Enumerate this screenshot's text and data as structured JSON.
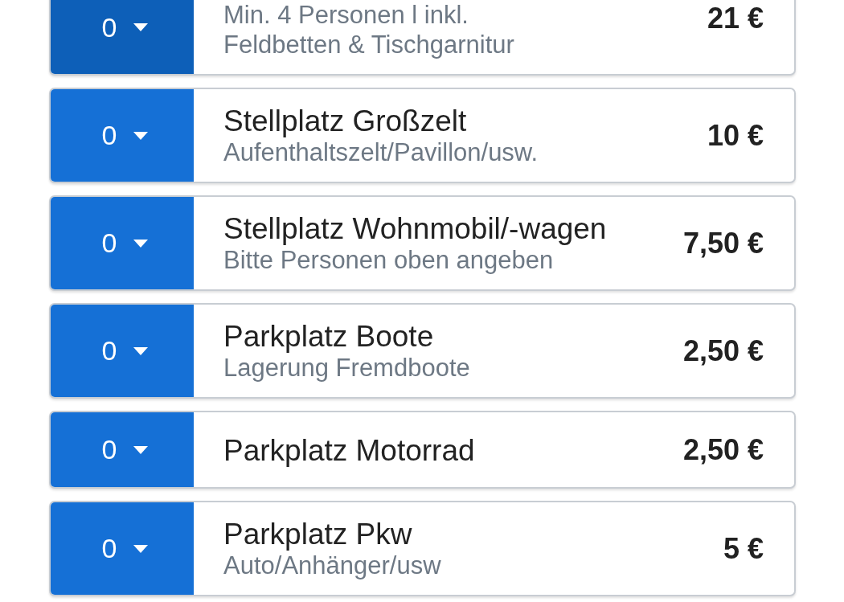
{
  "items": [
    {
      "quantity": "0",
      "selected": true,
      "subtitle_lines": [
        "Min. 4 Personen l inkl.",
        "Feldbetten & Tischgarnitur"
      ],
      "price": "21 €"
    },
    {
      "quantity": "0",
      "selected": false,
      "title": "Stellplatz Großzelt",
      "subtitle_lines": [
        "Aufenthaltszelt/Pavillon/usw."
      ],
      "price": "10 €"
    },
    {
      "quantity": "0",
      "selected": false,
      "title": "Stellplatz Wohnmobil/-wagen",
      "subtitle_lines": [
        "Bitte Personen oben angeben"
      ],
      "price": "7,50 €"
    },
    {
      "quantity": "0",
      "selected": false,
      "title": "Parkplatz Boote",
      "subtitle_lines": [
        "Lagerung Fremdboote"
      ],
      "price": "2,50 €"
    },
    {
      "quantity": "0",
      "selected": false,
      "title": "Parkplatz Motorrad",
      "price": "2,50 €"
    },
    {
      "quantity": "0",
      "selected": false,
      "title": "Parkplatz Pkw",
      "subtitle_lines": [
        "Auto/Anhänger/usw"
      ],
      "price": "5 €"
    }
  ]
}
